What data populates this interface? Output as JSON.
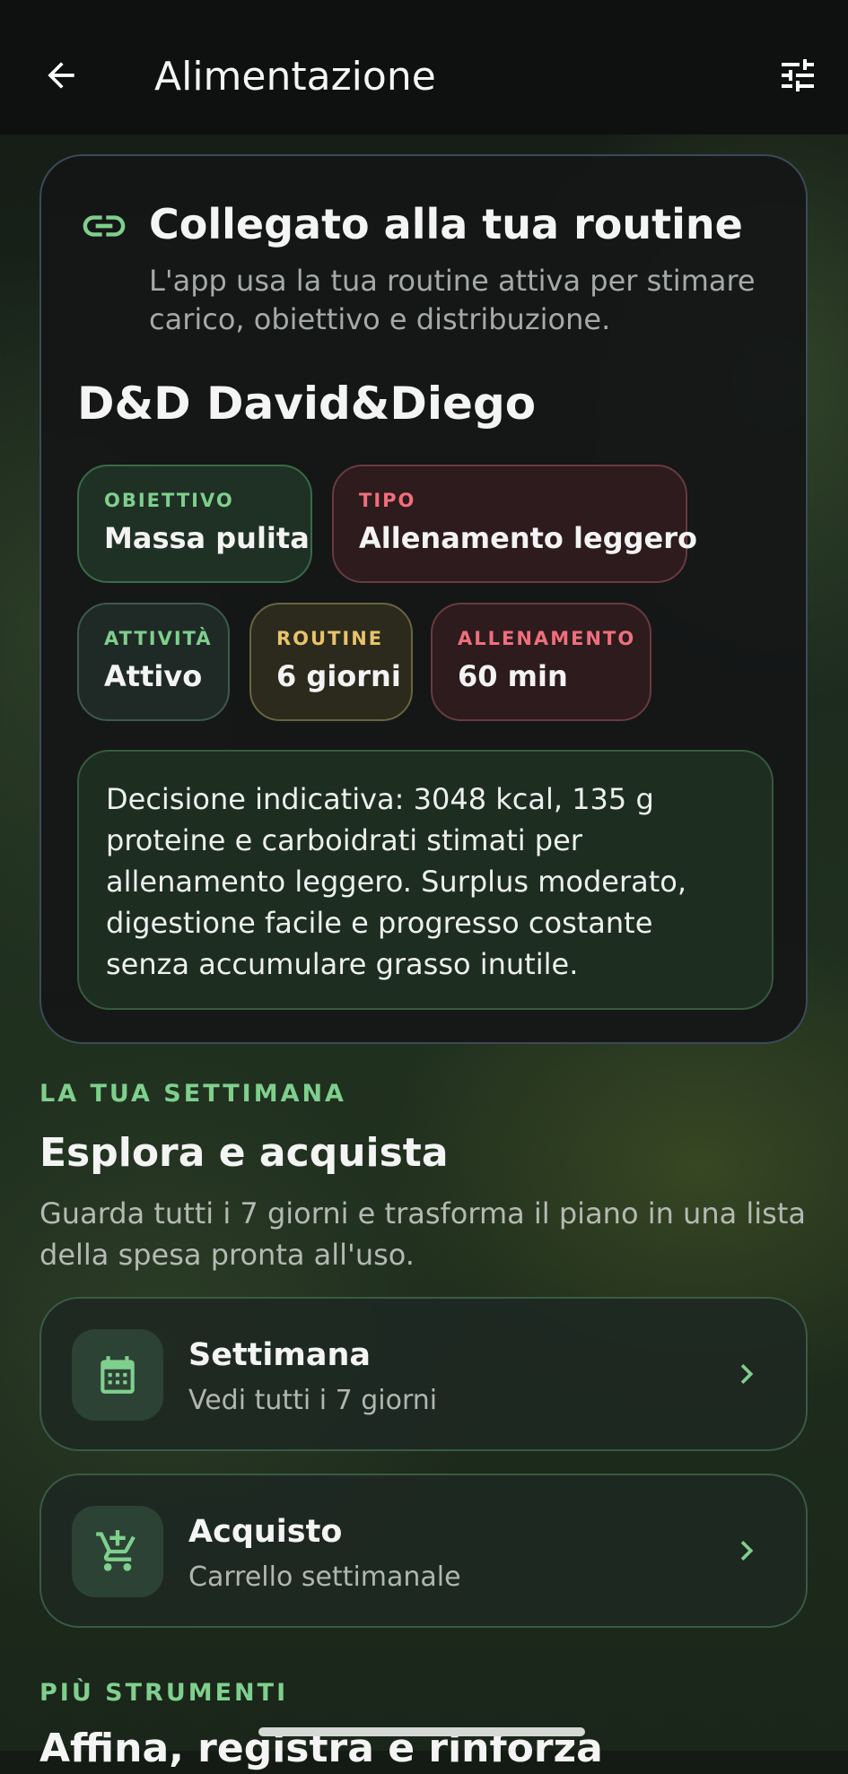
{
  "header": {
    "title": "Alimentazione",
    "back_icon": "arrow-back-icon",
    "filter_icon": "tune-icon"
  },
  "routine_card": {
    "icon": "link-icon",
    "title": "Collegato alla tua routine",
    "subtitle": "L'app usa la tua routine attiva per stimare carico, obiettivo e distribuzione.",
    "routine_name": "D&D David&Diego",
    "chips": [
      {
        "label": "OBIETTIVO",
        "value": "Massa pulita",
        "color": "#7fcf8d"
      },
      {
        "label": "TIPO",
        "value": "Allenamento leggero",
        "color": "#ef6f7c"
      },
      {
        "label": "ATTIVITÀ",
        "value": "Attivo",
        "color": "#7fcf8d"
      },
      {
        "label": "ROUTINE",
        "value": "6 giorni",
        "color": "#e8c36a"
      },
      {
        "label": "ALLENAMENTO",
        "value": "60 min",
        "color": "#ef6f7c"
      }
    ],
    "decision": "Decisione indicativa: 3048 kcal, 135 g proteine e carboidrati stimati per allenamento leggero. Surplus moderato, digestione facile e progresso costante senza accumulare grasso inutile."
  },
  "week_section": {
    "kicker": "LA TUA SETTIMANA",
    "title": "Esplora e acquista",
    "description": "Guarda tutti i 7 giorni e trasforma il piano in una lista della spesa pronta all'uso.",
    "items": [
      {
        "title": "Settimana",
        "subtitle": "Vedi tutti i 7 giorni",
        "icon": "calendar-icon"
      },
      {
        "title": "Acquisto",
        "subtitle": "Carrello settimanale",
        "icon": "add-shopping-cart-icon"
      }
    ]
  },
  "more_section": {
    "kicker": "PIÙ STRUMENTI",
    "title": "Affina, registra e rinforza"
  },
  "colors": {
    "accent": "#7fcf8d",
    "card_background": "#141616",
    "header_background": "#0f1110"
  }
}
